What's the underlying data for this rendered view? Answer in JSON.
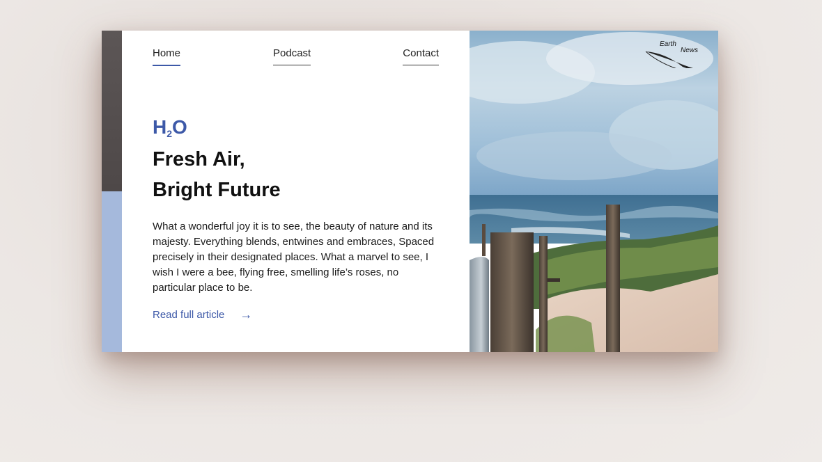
{
  "nav": {
    "home": "Home",
    "podcast": "Podcast",
    "contact": "Contact"
  },
  "brand": {
    "main_a": "H",
    "sub": "2",
    "main_b": "O"
  },
  "headline": {
    "line1": "Fresh Air,",
    "line2": "Bright Future"
  },
  "article": {
    "body": "What a wonderful joy it is to see, the beauty of nature and its majesty. Everything blends, entwines and embraces, Spaced precisely in their designated places. What a marvel to see, I wish I were a bee, flying free, smelling life’s roses, no particular place to be.",
    "read_more": "Read full article",
    "arrow_icon": "→"
  },
  "logo": {
    "word1": "Earth",
    "word2": "News",
    "icon": "feather-icon"
  },
  "colors": {
    "accent_blue": "#3d59a8",
    "sidebar_dark": "#4e4848",
    "sidebar_light": "#a5b9dc"
  }
}
